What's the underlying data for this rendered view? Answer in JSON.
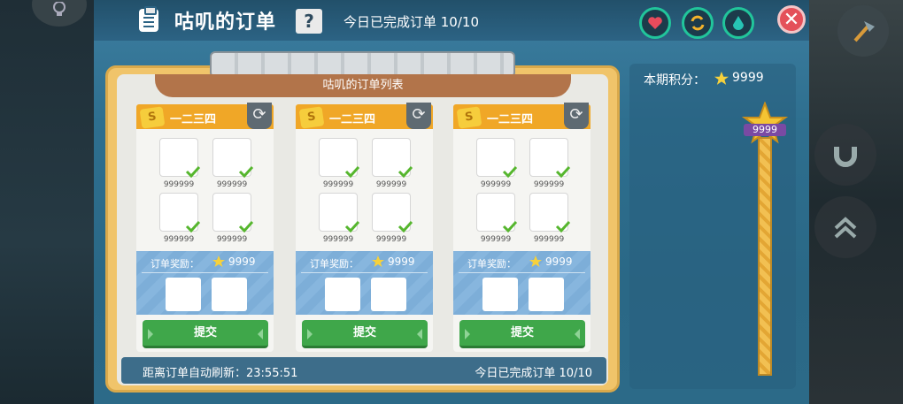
{
  "header": {
    "title": "咕叽的订单",
    "help_label": "?",
    "today_done": "今日已完成订单 10/10",
    "close_label": "✕"
  },
  "status_icons": [
    "heart-icon",
    "swap-icon",
    "drop-icon"
  ],
  "order_list": {
    "ribbon_title": "咕叽的订单列表",
    "columns": [
      {
        "name": "一二三四",
        "coin_label": "S",
        "item_counts": [
          "999999",
          "999999",
          "999999",
          "999999"
        ],
        "reward_label": "订单奖励：",
        "reward_value": "9999",
        "submit_label": "提交"
      },
      {
        "name": "一二三四",
        "coin_label": "S",
        "item_counts": [
          "999999",
          "999999",
          "999999",
          "999999"
        ],
        "reward_label": "订单奖励：",
        "reward_value": "9999",
        "submit_label": "提交"
      },
      {
        "name": "一二三四",
        "coin_label": "S",
        "item_counts": [
          "999999",
          "999999",
          "999999",
          "999999"
        ],
        "reward_label": "订单奖励：",
        "reward_value": "9999",
        "submit_label": "提交"
      }
    ],
    "footer_refresh": "距离订单自动刷新：23:55:51",
    "footer_today": "今日已完成订单 10/10"
  },
  "points": {
    "label": "本期积分：",
    "value": "9999",
    "badge": "9999"
  },
  "colors": {
    "panel": "#2e6f8f",
    "accent_orange": "#f0a727",
    "submit_green": "#3fa74a",
    "close_red": "#e4505a"
  }
}
